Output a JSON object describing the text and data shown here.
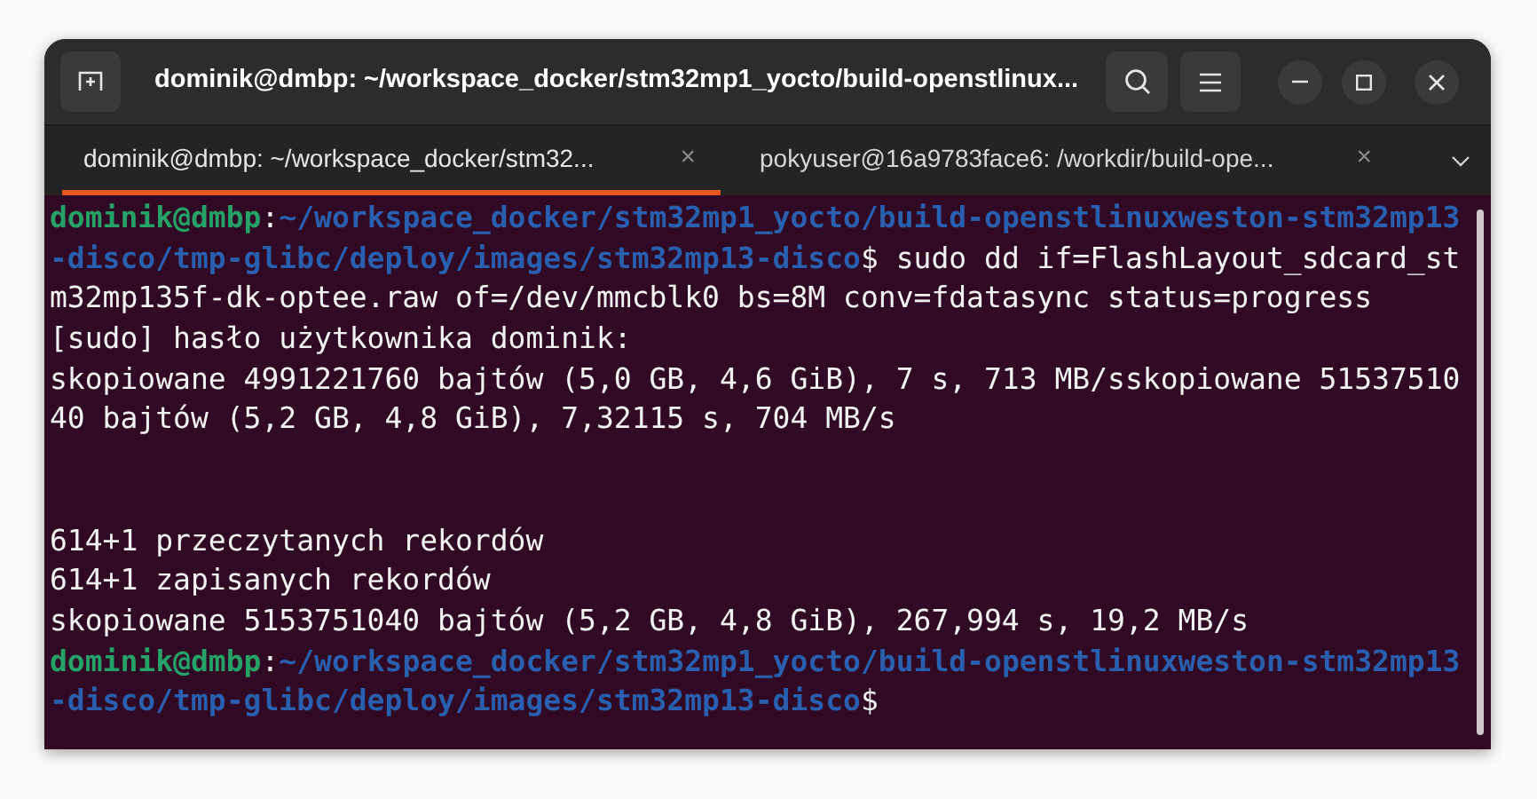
{
  "window": {
    "title": "dominik@dmbp: ~/workspace_docker/stm32mp1_yocto/build-openstlinux..."
  },
  "tabs": [
    {
      "label": "dominik@dmbp: ~/workspace_docker/stm32...",
      "close": "×",
      "selected": true
    },
    {
      "label": "pokyuser@16a9783face6: /workdir/build-ope...",
      "close": "×",
      "selected": false
    }
  ],
  "terminal": {
    "rows": [
      {
        "kind": "text",
        "segments": [
          {
            "kind": "user",
            "text": "dominik@dmbp"
          },
          {
            "kind": "plain",
            "text": ":"
          },
          {
            "kind": "path",
            "text": "~/workspace_docker/stm32mp1_yocto/build-openstlinuxweston-stm32mp13"
          }
        ]
      },
      {
        "kind": "text",
        "segments": [
          {
            "kind": "path",
            "text": "-disco/tmp-glibc/deploy/images/stm32mp13-disco"
          },
          {
            "kind": "plain",
            "text": "$ sudo dd if=FlashLayout_sdcard_st"
          }
        ]
      },
      {
        "kind": "text",
        "segments": [
          {
            "kind": "plain",
            "text": "m32mp135f-dk-optee.raw of=/dev/mmcblk0 bs=8M conv=fdatasync status=progress"
          }
        ]
      },
      {
        "kind": "text",
        "segments": [
          {
            "kind": "plain",
            "text": "[sudo] hasło użytkownika dominik:"
          }
        ]
      },
      {
        "kind": "text",
        "segments": [
          {
            "kind": "plain",
            "text": "skopiowane 4991221760 bajtów (5,0 GB, 4,6 GiB), 7 s, 713 MB/sskopiowane 51537510"
          }
        ]
      },
      {
        "kind": "text",
        "segments": [
          {
            "kind": "plain",
            "text": "40 bajtów (5,2 GB, 4,8 GiB), 7,32115 s, 704 MB/s"
          }
        ]
      },
      {
        "kind": "blank"
      },
      {
        "kind": "blank"
      },
      {
        "kind": "text",
        "segments": [
          {
            "kind": "plain",
            "text": "614+1 przeczytanych rekordów"
          }
        ]
      },
      {
        "kind": "text",
        "segments": [
          {
            "kind": "plain",
            "text": "614+1 zapisanych rekordów"
          }
        ]
      },
      {
        "kind": "text",
        "segments": [
          {
            "kind": "plain",
            "text": "skopiowane 5153751040 bajtów (5,2 GB, 4,8 GiB), 267,994 s, 19,2 MB/s"
          }
        ]
      },
      {
        "kind": "text",
        "segments": [
          {
            "kind": "user",
            "text": "dominik@dmbp"
          },
          {
            "kind": "plain",
            "text": ":"
          },
          {
            "kind": "path",
            "text": "~/workspace_docker/stm32mp1_yocto/build-openstlinuxweston-stm32mp13"
          }
        ]
      },
      {
        "kind": "text",
        "segments": [
          {
            "kind": "path",
            "text": "-disco/tmp-glibc/deploy/images/stm32mp13-disco"
          },
          {
            "kind": "plain",
            "text": "$"
          }
        ]
      }
    ]
  }
}
